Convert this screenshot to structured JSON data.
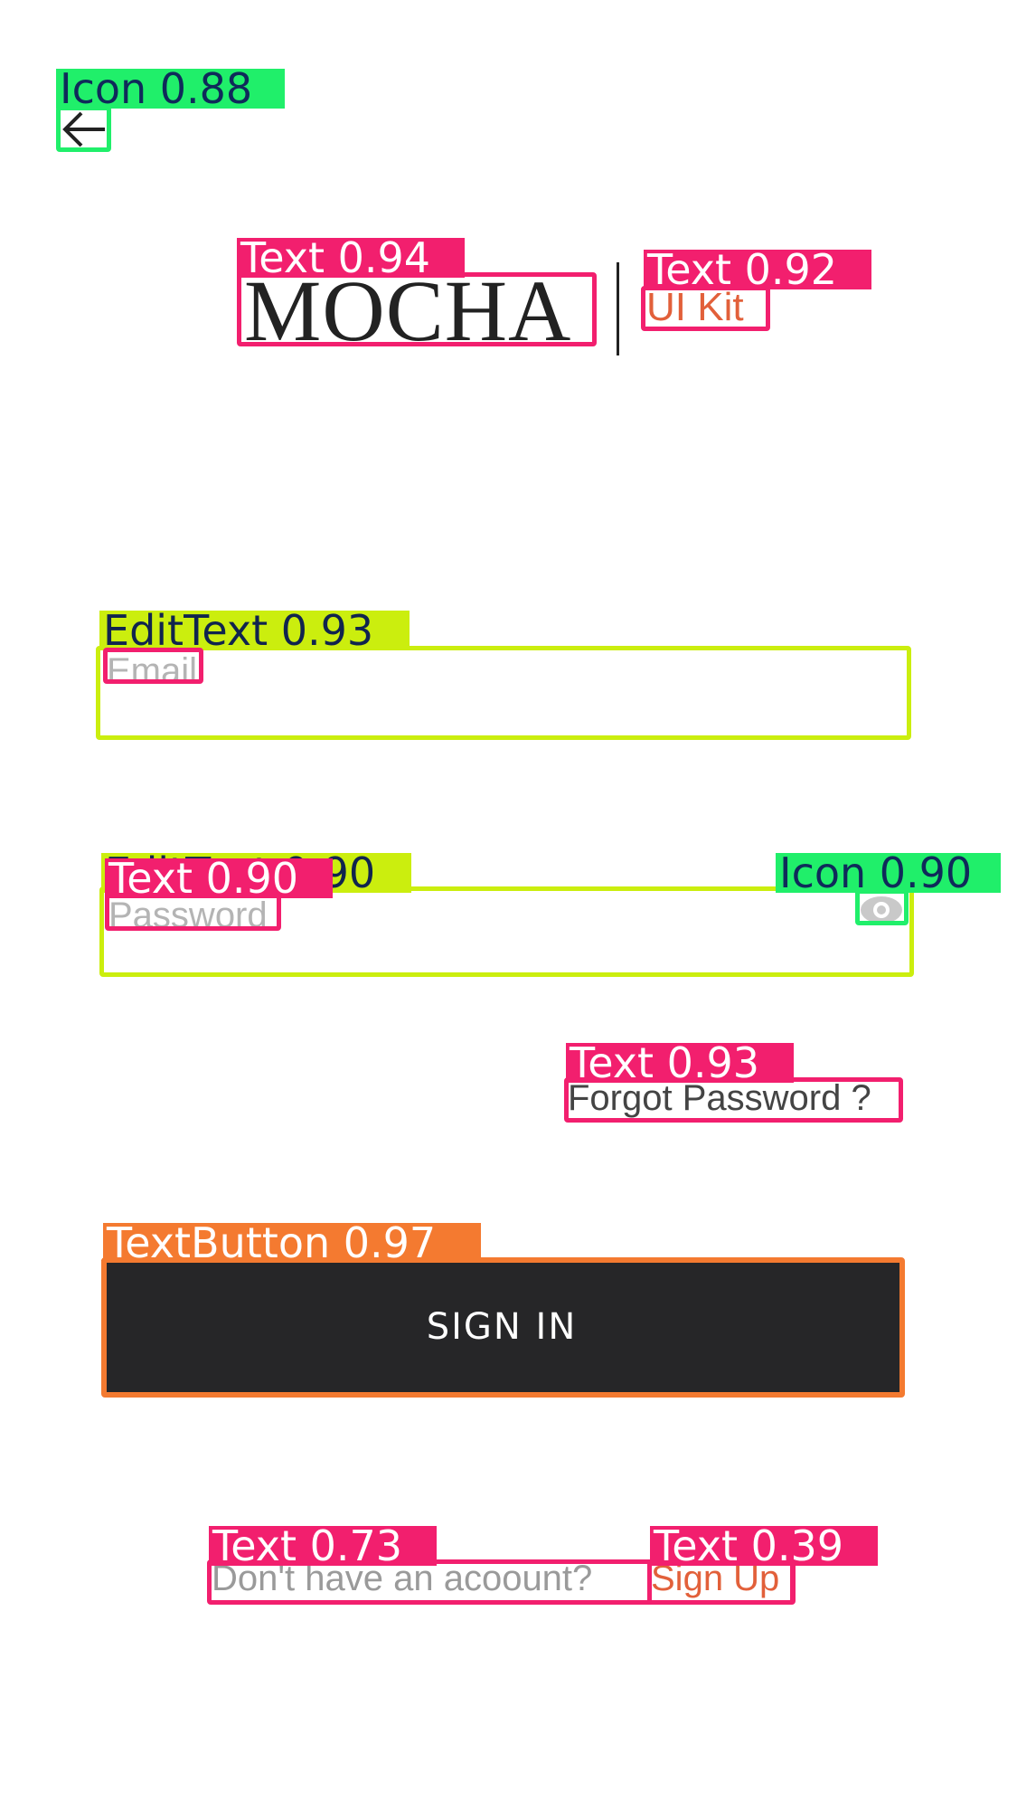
{
  "header": {
    "back_icon": "arrow-left-icon",
    "logo_text": "MOCHA",
    "logo_sub": "UI Kit"
  },
  "form": {
    "email_placeholder": "Email",
    "password_placeholder": "Password",
    "password_icon": "eye-icon",
    "forgot_label": "Forgot Password ?",
    "signin_label": "SIGN IN"
  },
  "footer": {
    "prompt_text": "Don't have an acoount?",
    "signup_label": "Sign Up"
  },
  "detections": {
    "back_icon": "Icon  0.88",
    "logo_text": "Text  0.94",
    "logo_sub": "Text  0.92",
    "email_field": "EditText  0.93",
    "password_field": "EditText  0.90",
    "password_text": "Text  0.90",
    "eye_icon": "Icon  0.90",
    "forgot_text": "Text  0.93",
    "signin_button": "TextButton  0.97",
    "prompt_text": "Text  0.73",
    "signup_text": "Text  0.39"
  },
  "colors": {
    "text_box": "#f21f6e",
    "icon_box": "#20ef6a",
    "edittext_box": "#cbee0e",
    "button_box": "#f47a30",
    "button_bg": "#262628",
    "accent": "#e2603a"
  }
}
